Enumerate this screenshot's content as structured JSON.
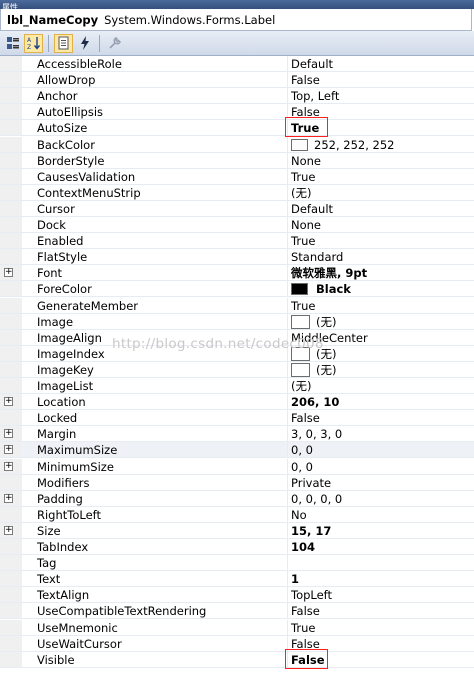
{
  "title_bar": {
    "title": "属性"
  },
  "object": {
    "name": "lbl_NameCopy",
    "type": "System.Windows.Forms.Label"
  },
  "toolbar": {
    "buttons": [
      {
        "icon": "categorized-icon",
        "active": false
      },
      {
        "icon": "alphabetical-icon",
        "active": true
      },
      {
        "icon": "properties-icon",
        "active": true
      },
      {
        "icon": "events-lightning-icon",
        "active": false
      },
      {
        "icon": "property-pages-wrench-icon",
        "active": false
      }
    ]
  },
  "watermark": "http://blog.csdn.net/codec008",
  "highlight_color": "#ff1f1f",
  "properties": [
    {
      "name": "AccessibleRole",
      "value": "Default"
    },
    {
      "name": "AllowDrop",
      "value": "False"
    },
    {
      "name": "Anchor",
      "value": "Top, Left"
    },
    {
      "name": "AutoEllipsis",
      "value": "False"
    },
    {
      "name": "AutoSize",
      "value": "True",
      "bold": true,
      "highlight": true
    },
    {
      "name": "BackColor",
      "value": "252, 252, 252",
      "swatch": "#fcfcfc"
    },
    {
      "name": "BorderStyle",
      "value": "None"
    },
    {
      "name": "CausesValidation",
      "value": "True"
    },
    {
      "name": "ContextMenuStrip",
      "value": "(无)"
    },
    {
      "name": "Cursor",
      "value": "Default"
    },
    {
      "name": "Dock",
      "value": "None"
    },
    {
      "name": "Enabled",
      "value": "True"
    },
    {
      "name": "FlatStyle",
      "value": "Standard"
    },
    {
      "name": "Font",
      "value": "微软雅黑, 9pt",
      "bold": true,
      "expandable": true
    },
    {
      "name": "ForeColor",
      "value": "Black",
      "bold": true,
      "swatch": "#000000"
    },
    {
      "name": "GenerateMember",
      "value": "True"
    },
    {
      "name": "Image",
      "value": "(无)",
      "imgbox": true
    },
    {
      "name": "ImageAlign",
      "value": "MiddleCenter"
    },
    {
      "name": "ImageIndex",
      "value": "(无)",
      "imgbox": true
    },
    {
      "name": "ImageKey",
      "value": "(无)",
      "imgbox": true
    },
    {
      "name": "ImageList",
      "value": "(无)"
    },
    {
      "name": "Location",
      "value": "206, 10",
      "bold": true,
      "expandable": true
    },
    {
      "name": "Locked",
      "value": "False"
    },
    {
      "name": "Margin",
      "value": "3, 0, 3, 0",
      "expandable": true
    },
    {
      "name": "MaximumSize",
      "value": "0, 0",
      "expandable": true,
      "selected": true
    },
    {
      "name": "MinimumSize",
      "value": "0, 0",
      "expandable": true
    },
    {
      "name": "Modifiers",
      "value": "Private"
    },
    {
      "name": "Padding",
      "value": "0, 0, 0, 0",
      "expandable": true
    },
    {
      "name": "RightToLeft",
      "value": "No"
    },
    {
      "name": "Size",
      "value": "15, 17",
      "bold": true,
      "expandable": true
    },
    {
      "name": "TabIndex",
      "value": "104",
      "bold": true
    },
    {
      "name": "Tag",
      "value": ""
    },
    {
      "name": "Text",
      "value": "1",
      "bold": true
    },
    {
      "name": "TextAlign",
      "value": "TopLeft"
    },
    {
      "name": "UseCompatibleTextRendering",
      "value": "False"
    },
    {
      "name": "UseMnemonic",
      "value": "True"
    },
    {
      "name": "UseWaitCursor",
      "value": "False"
    },
    {
      "name": "Visible",
      "value": "False",
      "bold": true,
      "highlight": true
    }
  ]
}
